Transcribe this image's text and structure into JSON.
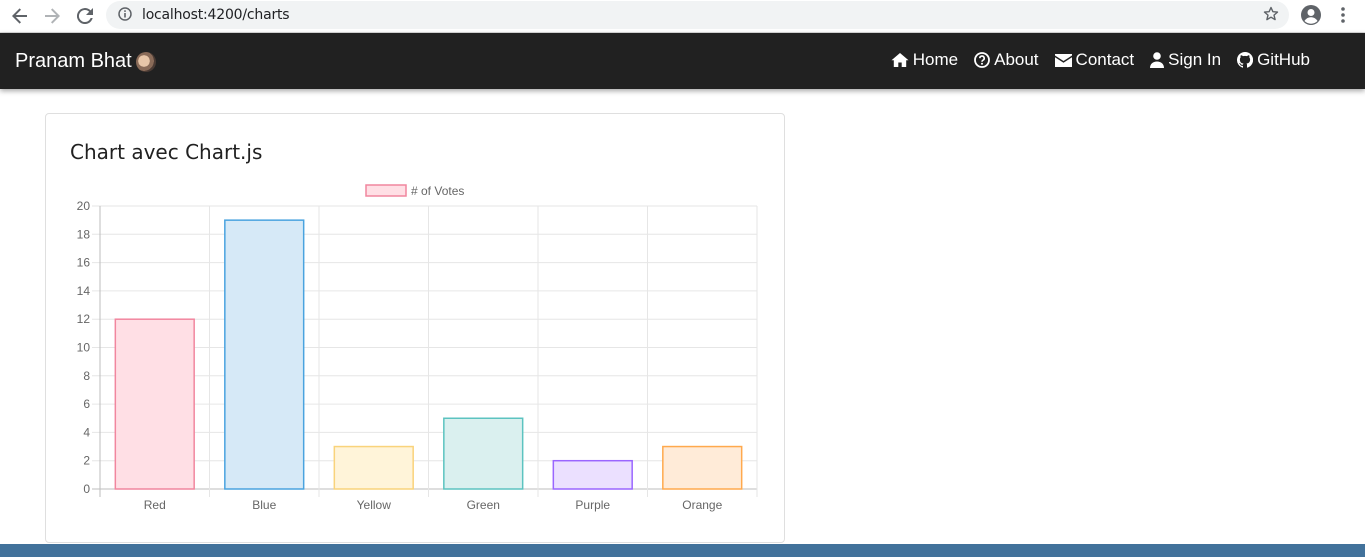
{
  "browser": {
    "url": "localhost:4200/charts"
  },
  "navbar": {
    "brand": "Pranam Bhat",
    "links": [
      {
        "label": "Home",
        "icon": "home-icon"
      },
      {
        "label": "About",
        "icon": "question-circle-icon"
      },
      {
        "label": "Contact",
        "icon": "envelope-icon"
      },
      {
        "label": "Sign In",
        "icon": "user-icon"
      },
      {
        "label": "GitHub",
        "icon": "github-icon"
      }
    ]
  },
  "card": {
    "title": "Chart avec Chart.js"
  },
  "chart_data": {
    "type": "bar",
    "categories": [
      "Red",
      "Blue",
      "Yellow",
      "Green",
      "Purple",
      "Orange"
    ],
    "series": [
      {
        "name": "# of Votes",
        "values": [
          12,
          19,
          3,
          5,
          2,
          3
        ],
        "fill_colors": [
          "#ffdfe5",
          "#d6e9f7",
          "#fff4d9",
          "#daf0ef",
          "#ebe0ff",
          "#ffebd8"
        ],
        "border_colors": [
          "#f1869e",
          "#4aa3df",
          "#f9d37b",
          "#5cc3c0",
          "#9a66ff",
          "#ffa94d"
        ]
      }
    ],
    "ylim": [
      0,
      20
    ],
    "yticks": [
      0,
      2,
      4,
      6,
      8,
      10,
      12,
      14,
      16,
      18,
      20
    ],
    "grid": true,
    "legend": "top-center"
  },
  "colors": {
    "navbar_bg": "#212121",
    "footer_bg": "#42729b"
  }
}
